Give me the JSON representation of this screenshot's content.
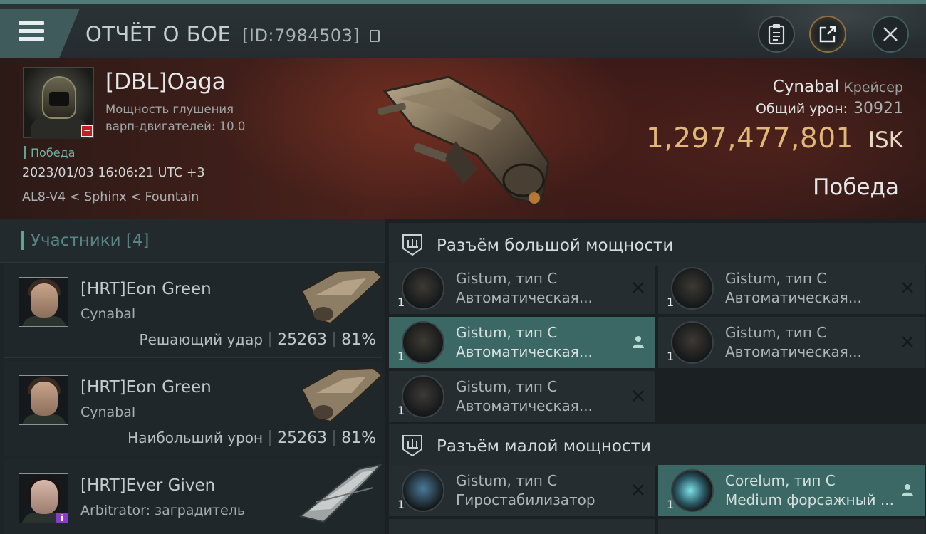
{
  "header": {
    "title": "ОТЧЁТ О БОЕ",
    "id_text": "[ID:7984503]"
  },
  "victim": {
    "name": "[DBL]Oaga",
    "warp_line1": "Мощность глушения",
    "warp_line2": "варп-двигателей: 10.0",
    "status": "Победа",
    "datetime": "2023/01/03 16:06:21 UTC +3",
    "location": "AL8-V4 < Sphinx < Fountain",
    "ship_name": "Cynabal",
    "ship_class": "Крейсер",
    "damage_label": "Общий урон:",
    "damage_value": "30921",
    "isk_value": "1,297,477,801",
    "isk_unit": "ISK",
    "result": "Победа"
  },
  "participants": {
    "title": "Участники [4]",
    "items": [
      {
        "name": "[HRT]Eon Green",
        "ship": "Cynabal",
        "label": "Решающий удар",
        "damage": "25263",
        "percent": "81%"
      },
      {
        "name": "[HRT]Eon Green",
        "ship": "Cynabal",
        "label": "Наибольший урон",
        "damage": "25263",
        "percent": "81%"
      },
      {
        "name": "[HRT]Ever Given",
        "ship": "Arbitrator: заградитель",
        "label": "",
        "damage": "",
        "percent": ""
      }
    ]
  },
  "fitting": {
    "high_title": "Разъём большой мощности",
    "low_title": "Разъём малой мощности",
    "high_slots": [
      {
        "name": "Gistum, тип C",
        "type": "Автоматическая...",
        "qty": "1",
        "state": "destroyed"
      },
      {
        "name": "Gistum, тип C",
        "type": "Автоматическая...",
        "qty": "1",
        "state": "destroyed"
      },
      {
        "name": "Gistum, тип C",
        "type": "Автоматическая...",
        "qty": "1",
        "state": "dropped"
      },
      {
        "name": "Gistum, тип C",
        "type": "Автоматическая...",
        "qty": "1",
        "state": "destroyed"
      },
      {
        "name": "Gistum, тип C",
        "type": "Автоматическая...",
        "qty": "1",
        "state": "destroyed"
      }
    ],
    "low_slots": [
      {
        "name": "Gistum, тип C",
        "type": "Гиростабилизатор",
        "qty": "1",
        "state": "destroyed"
      },
      {
        "name": "Corelum, тип C",
        "type": "Medium форсажный ...",
        "qty": "1",
        "state": "dropped"
      }
    ]
  },
  "icons": {
    "menu": "hamburger-icon",
    "clipboard": "clipboard-icon",
    "share": "share-icon",
    "close": "close-icon",
    "destroyed": "x-icon",
    "dropped": "person-icon"
  },
  "colors": {
    "accent": "#5aa596",
    "isk": "#e2b87a",
    "active_slot": "#3b6764",
    "minus_badge": "#c02024"
  }
}
